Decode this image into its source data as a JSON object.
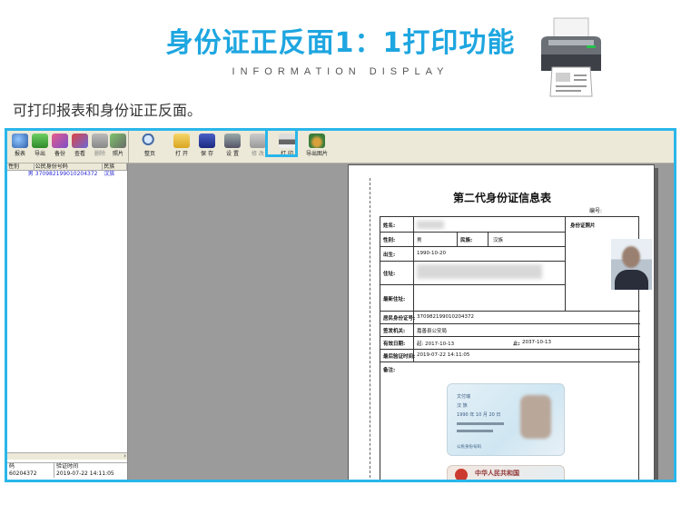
{
  "header": {
    "title": "身份证正反面1：1打印功能",
    "subtitle": "INFORMATION DISPLAY"
  },
  "intro": "可打印报表和身份证正反面。",
  "toolbar_left": [
    {
      "icon": "report-icon",
      "label": "报表"
    },
    {
      "icon": "export-icon",
      "label": "导出"
    },
    {
      "icon": "backup-icon",
      "label": "备份"
    },
    {
      "icon": "view-icon",
      "label": "查看"
    },
    {
      "icon": "delete-icon",
      "label": "删除"
    },
    {
      "icon": "photo-icon",
      "label": "照片"
    }
  ],
  "toolbar_right": [
    {
      "icon": "zoom-icon",
      "label": "整页"
    },
    {
      "icon": "open-folder-icon",
      "label": "打 开"
    },
    {
      "icon": "save-icon",
      "label": "保 存"
    },
    {
      "icon": "settings-icon",
      "label": "设 置"
    },
    {
      "icon": "edit-icon",
      "label": "修 改"
    },
    {
      "icon": "printer-icon",
      "label": "打 印"
    },
    {
      "icon": "export-image-icon",
      "label": "导出图片"
    }
  ],
  "grid": {
    "headers": [
      "性别",
      "公民身份号码",
      "民族"
    ],
    "rows": [
      [
        "男",
        "370982199010204372",
        "汉族"
      ]
    ]
  },
  "bottom_grid": {
    "headers": [
      "码",
      "验证时间"
    ],
    "rows": [
      [
        "60204372",
        "2019-07-22 14:11:05"
      ]
    ]
  },
  "document": {
    "title": "第二代身份证信息表",
    "number_label": "编号:",
    "labels": {
      "name": "姓名:",
      "gender": "性别:",
      "ethnicity": "民族:",
      "birth": "出生:",
      "address": "住址:",
      "new_address": "最新住址:",
      "id_number": "居民身份证号:",
      "issuer": "签发机关:",
      "valid_date": "有效日期:",
      "verify_time": "最后验证时间:",
      "remarks": "备注:",
      "photo": "身份证照片",
      "to": "止:"
    },
    "values": {
      "gender": "男",
      "ethnicity": "汉族",
      "birth": "1990-10-20",
      "id_number": "370982199010204372",
      "issuer": "嘉善县公安局",
      "valid_from": "起: 2017-10-13",
      "valid_to": "2037-10-13",
      "verify_time": "2019-07-22 14:11:05"
    },
    "card_front": {
      "name": "文付瑞",
      "ethnicity": "汉 族",
      "birth": "1990 年 10 月 20 日",
      "id_label": "公民身份号码"
    },
    "card_back": {
      "title": "中华人民共和国"
    }
  },
  "colors": {
    "accent": "#1ea6e0",
    "frame": "#29b6ea",
    "preview_bg": "#9b9b9b"
  }
}
